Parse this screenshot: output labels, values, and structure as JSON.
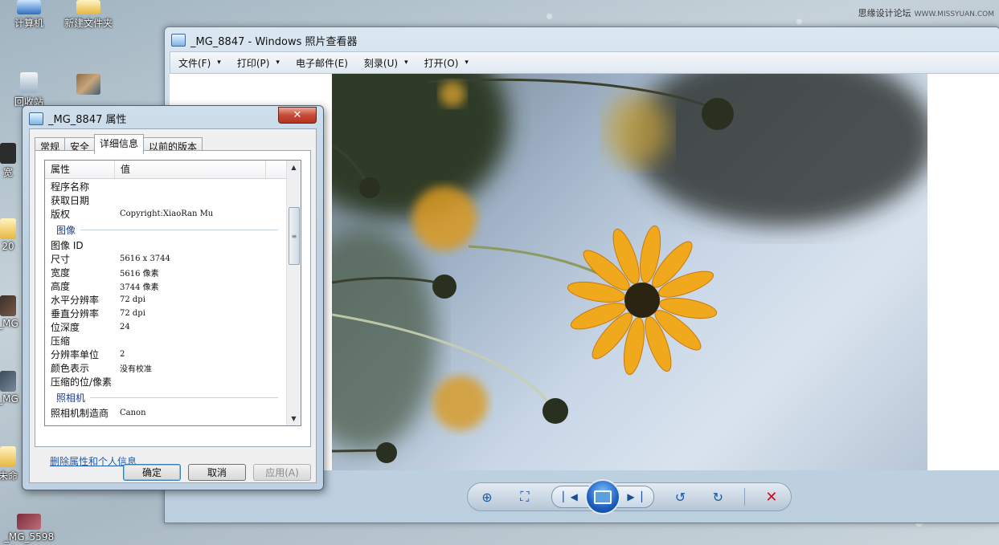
{
  "watermark": {
    "text": "思缘设计论坛",
    "site": "WWW.MISSYUAN.COM"
  },
  "desktop_icons": [
    {
      "label": "计算机",
      "icon": "computer-icon"
    },
    {
      "label": "新建文件夹",
      "icon": "folder-icon"
    },
    {
      "label": "回收站",
      "icon": "recycle-bin-icon"
    },
    {
      "label": "宽",
      "icon": "shortcut-icon"
    },
    {
      "label": "20",
      "icon": "folder-icon"
    },
    {
      "label": "_MG",
      "icon": "image-file-icon"
    },
    {
      "label": "_MG",
      "icon": "image-file-icon"
    },
    {
      "label": "未命",
      "icon": "folder-icon"
    },
    {
      "label": "_MG_5598",
      "icon": "image-file-icon"
    }
  ],
  "viewer": {
    "title": "_MG_8847 - Windows 照片查看器",
    "menu": [
      {
        "label": "文件(F)",
        "has_caret": true
      },
      {
        "label": "打印(P)",
        "has_caret": true
      },
      {
        "label": "电子邮件(E)",
        "has_caret": false
      },
      {
        "label": "刻录(U)",
        "has_caret": true
      },
      {
        "label": "打开(O)",
        "has_caret": true
      }
    ],
    "caret": "▾",
    "controls": {
      "zoom": "zoom-icon",
      "actual_size": "fit-window-icon",
      "previous": "previous-icon",
      "slideshow": "slideshow-icon",
      "next": "next-icon",
      "rotate_ccw": "rotate-ccw-icon",
      "rotate_cw": "rotate-cw-icon",
      "delete": "delete-icon"
    }
  },
  "dialog": {
    "title": "_MG_8847 属性",
    "close": "✕",
    "tabs": [
      {
        "label": "常规",
        "active": false
      },
      {
        "label": "安全",
        "active": false
      },
      {
        "label": "详细信息",
        "active": true
      },
      {
        "label": "以前的版本",
        "active": false
      }
    ],
    "columns": {
      "property": "属性",
      "value": "值"
    },
    "rows_top": [
      {
        "k": "程序名称",
        "v": ""
      },
      {
        "k": "获取日期",
        "v": ""
      },
      {
        "k": "版权",
        "v": "Copyright:XiaoRan Mu"
      }
    ],
    "group_image": "图像",
    "rows_image": [
      {
        "k": "图像 ID",
        "v": ""
      },
      {
        "k": "尺寸",
        "v": "5616 x 3744"
      },
      {
        "k": "宽度",
        "v": "5616 像素"
      },
      {
        "k": "高度",
        "v": "3744 像素"
      },
      {
        "k": "水平分辨率",
        "v": "72 dpi"
      },
      {
        "k": "垂直分辨率",
        "v": "72 dpi"
      },
      {
        "k": "位深度",
        "v": "24"
      },
      {
        "k": "压缩",
        "v": ""
      },
      {
        "k": "分辨率单位",
        "v": "2"
      },
      {
        "k": "颜色表示",
        "v": "没有校准"
      },
      {
        "k": "压缩的位/像素",
        "v": ""
      }
    ],
    "group_camera": "照相机",
    "rows_camera": [
      {
        "k": "照相机制造商",
        "v": "Canon"
      }
    ],
    "delete_link": "删除属性和个人信息",
    "ok": "确定",
    "cancel": "取消",
    "apply": "应用(A)"
  }
}
